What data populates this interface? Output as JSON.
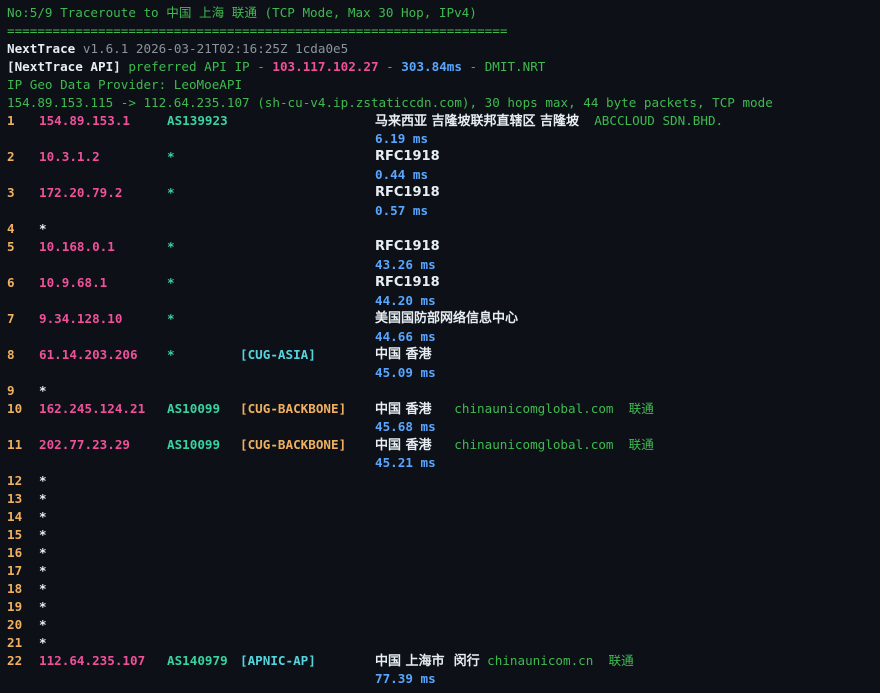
{
  "header": {
    "title": "No:5/9 Traceroute to 中国 上海 联通 (TCP Mode, Max 30 Hop, IPv4)",
    "rule": "==================================================================",
    "app_name": "NextTrace",
    "app_meta": " v1.6.1 2026-03-21T02:16:25Z 1cda0e5",
    "api_tag": "[NextTrace API]",
    "api_text": " preferred API IP - ",
    "api_ip": "103.117.102.27",
    "api_sep": " - ",
    "api_latency": "303.84ms",
    "api_sep2": " - ",
    "api_node": "DMIT.NRT",
    "geo_provider": "IP Geo Data Provider: LeoMoeAPI",
    "route_line": "154.89.153.115 -> 112.64.235.107 (sh-cu-v4.ip.zstaticcdn.com), 30 hops max, 44 byte packets, TCP mode"
  },
  "hops": [
    {
      "num": "1",
      "ip": "154.89.153.1",
      "asn": "AS139923",
      "tag": "",
      "tag_type": "",
      "geo": "马来西亚 吉隆坡联邦直辖区 吉隆坡",
      "org": "  ABCCLOUD SDN.BHD.",
      "latency": "6.19 ms"
    },
    {
      "num": "2",
      "ip": "10.3.1.2",
      "asn": "*",
      "tag": "",
      "tag_type": "",
      "geo": "RFC1918",
      "org": "",
      "latency": "0.44 ms"
    },
    {
      "num": "3",
      "ip": "172.20.79.2",
      "asn": "*",
      "tag": "",
      "tag_type": "",
      "geo": "RFC1918",
      "org": "",
      "latency": "0.57 ms"
    },
    {
      "num": "4",
      "star": "*"
    },
    {
      "num": "5",
      "ip": "10.168.0.1",
      "asn": "*",
      "tag": "",
      "tag_type": "",
      "geo": "RFC1918",
      "org": "",
      "latency": "43.26 ms"
    },
    {
      "num": "6",
      "ip": "10.9.68.1",
      "asn": "*",
      "tag": "",
      "tag_type": "",
      "geo": "RFC1918",
      "org": "",
      "latency": "44.20 ms"
    },
    {
      "num": "7",
      "ip": "9.34.128.10",
      "asn": "*",
      "tag": "",
      "tag_type": "",
      "geo": "美国国防部网络信息中心",
      "org": "",
      "latency": "44.66 ms"
    },
    {
      "num": "8",
      "ip": "61.14.203.206",
      "asn": "*",
      "tag": "[CUG-ASIA]",
      "tag_type": "asia",
      "geo": "中国 香港",
      "org": "",
      "latency": "45.09 ms"
    },
    {
      "num": "9",
      "star": "*"
    },
    {
      "num": "10",
      "ip": "162.245.124.21",
      "asn": "AS10099",
      "tag": "[CUG-BACKBONE]",
      "tag_type": "back",
      "geo": "中国 香港",
      "org": "   chinaunicomglobal.com  联通",
      "latency": "45.68 ms"
    },
    {
      "num": "11",
      "ip": "202.77.23.29",
      "asn": "AS10099",
      "tag": "[CUG-BACKBONE]",
      "tag_type": "back",
      "geo": "中国 香港",
      "org": "   chinaunicomglobal.com  联通",
      "latency": "45.21 ms"
    },
    {
      "num": "12",
      "star": "*"
    },
    {
      "num": "13",
      "star": "*"
    },
    {
      "num": "14",
      "star": "*"
    },
    {
      "num": "15",
      "star": "*"
    },
    {
      "num": "16",
      "star": "*"
    },
    {
      "num": "17",
      "star": "*"
    },
    {
      "num": "18",
      "star": "*"
    },
    {
      "num": "19",
      "star": "*"
    },
    {
      "num": "20",
      "star": "*"
    },
    {
      "num": "21",
      "star": "*"
    },
    {
      "num": "22",
      "ip": "112.64.235.107",
      "asn": "AS140979",
      "tag": "[APNIC-AP]",
      "tag_type": "apnic",
      "geo": "中国 上海市  闵行",
      "org": " chinaunicom.cn  联通",
      "latency": "77.39 ms"
    }
  ]
}
